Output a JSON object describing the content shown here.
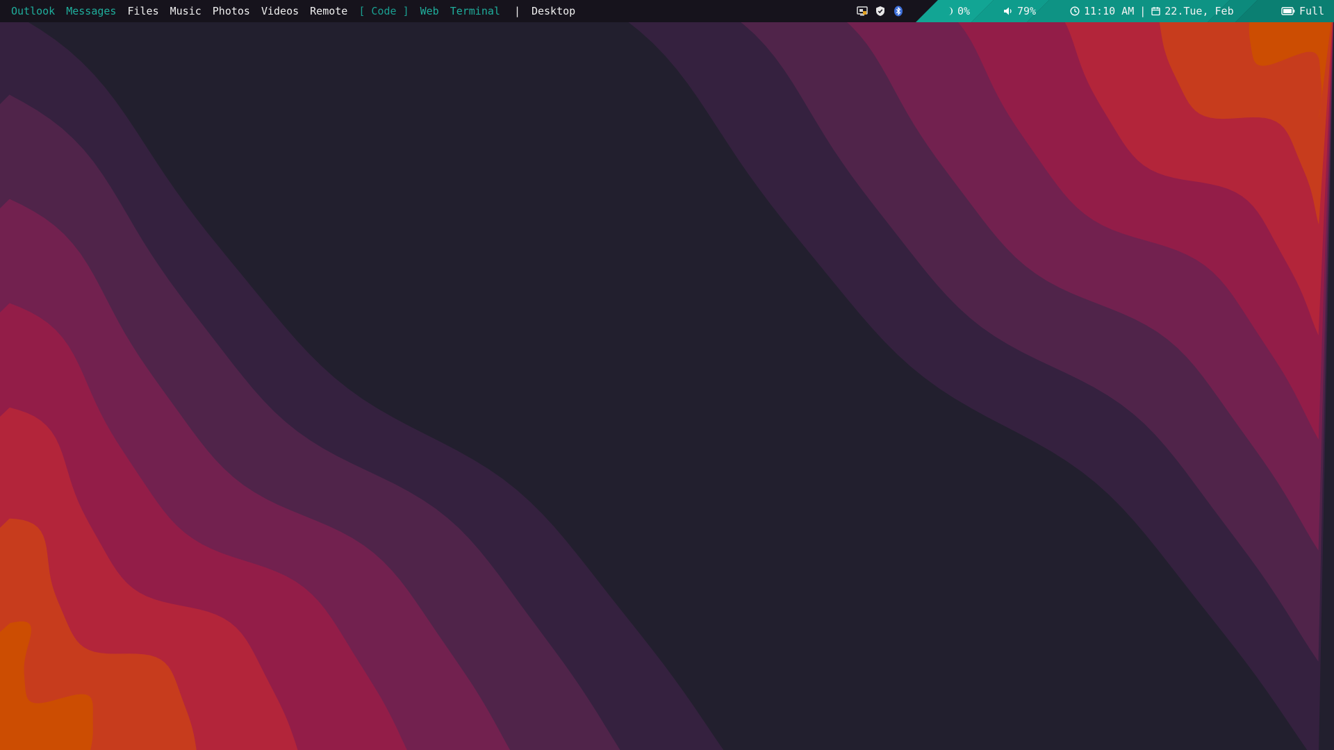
{
  "workspaces": [
    {
      "label": "Outlook",
      "state": "empty"
    },
    {
      "label": "Messages",
      "state": "empty"
    },
    {
      "label": "Files",
      "state": "occupied"
    },
    {
      "label": "Music",
      "state": "occupied"
    },
    {
      "label": "Photos",
      "state": "occupied"
    },
    {
      "label": "Videos",
      "state": "occupied"
    },
    {
      "label": "Remote",
      "state": "occupied"
    },
    {
      "label": "Code",
      "state": "active"
    },
    {
      "label": "Web",
      "state": "empty"
    },
    {
      "label": "Terminal",
      "state": "empty"
    }
  ],
  "bracket_open": "[",
  "bracket_close": "]",
  "separator": "|",
  "window_title": "Desktop",
  "tray": {
    "icons": [
      "screen-capture-icon",
      "vpn-shield-icon",
      "bluetooth-icon"
    ]
  },
  "modules": {
    "night_light": {
      "icon": "moon-icon",
      "value": "0%"
    },
    "volume": {
      "icon": "speaker-icon",
      "value": "79%"
    },
    "clock": {
      "icon": "clock-icon",
      "time": "11:10 AM",
      "separator": "|"
    },
    "date": {
      "icon": "calendar-icon",
      "value": "22.Tue, Feb"
    },
    "battery": {
      "icon": "battery-icon",
      "value": "Full",
      "level": 1.0
    }
  },
  "colors": {
    "bar_bg": "#16131c",
    "accent": "#1a9f91",
    "module_teal_1": "#12a594",
    "module_teal_2": "#0f9283",
    "module_teal_3": "#0b7f72",
    "wallpaper_bands": [
      "#cc4d02",
      "#c73c1d",
      "#b3253a",
      "#931d48",
      "#72214f",
      "#50244a",
      "#35213f",
      "#221f2e"
    ]
  }
}
